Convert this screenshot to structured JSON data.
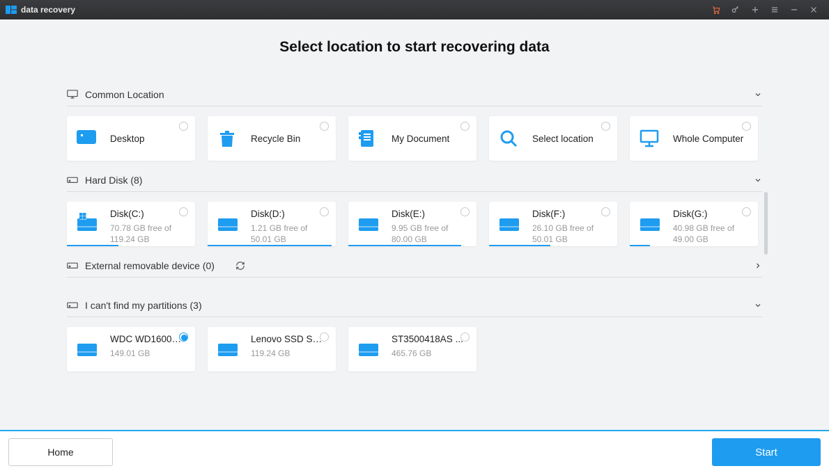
{
  "app": {
    "title": "data recovery"
  },
  "page_title": "Select location to start recovering data",
  "sections": {
    "common": {
      "label": "Common Location"
    },
    "hard_disk": {
      "label": "Hard Disk (8)"
    },
    "external": {
      "label": "External removable device (0)"
    },
    "lost": {
      "label": "I can't find my partitions (3)"
    }
  },
  "common_items": [
    {
      "label": "Desktop"
    },
    {
      "label": "Recycle Bin"
    },
    {
      "label": "My Document"
    },
    {
      "label": "Select location"
    },
    {
      "label": "Whole Computer"
    }
  ],
  "disks": [
    {
      "label": "Disk(C:)",
      "sub": "70.78 GB  free of 119.24 GB",
      "fill": 40
    },
    {
      "label": "Disk(D:)",
      "sub": "1.21 GB  free of 50.01 GB",
      "fill": 97
    },
    {
      "label": "Disk(E:)",
      "sub": "9.95 GB  free of 80.00 GB",
      "fill": 88
    },
    {
      "label": "Disk(F:)",
      "sub": "26.10 GB  free of 50.01 GB",
      "fill": 48
    },
    {
      "label": "Disk(G:)",
      "sub": "40.98 GB  free of 49.00 GB",
      "fill": 16
    }
  ],
  "lost_items": [
    {
      "label": "WDC WD1600A...",
      "sub": "149.01 GB",
      "selected": true
    },
    {
      "label": "Lenovo SSD SL...",
      "sub": "119.24 GB",
      "selected": false
    },
    {
      "label": "ST3500418AS ...",
      "sub": "465.76 GB",
      "selected": false
    }
  ],
  "buttons": {
    "home": "Home",
    "start": "Start"
  },
  "colors": {
    "accent": "#1e9cf0"
  }
}
